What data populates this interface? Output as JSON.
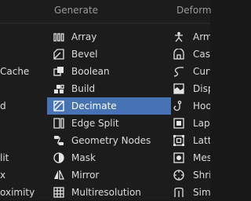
{
  "menu": {
    "left_items": [
      "Cache",
      "d",
      "lit",
      "x",
      "oximity"
    ],
    "columns": [
      {
        "header": "Generate",
        "items": [
          {
            "label": "Array",
            "icon": "array-icon"
          },
          {
            "label": "Bevel",
            "icon": "bevel-icon"
          },
          {
            "label": "Boolean",
            "icon": "boolean-icon"
          },
          {
            "label": "Build",
            "icon": "build-icon"
          },
          {
            "label": "Decimate",
            "icon": "decimate-icon",
            "active": true
          },
          {
            "label": "Edge Split",
            "icon": "edge-split-icon"
          },
          {
            "label": "Geometry Nodes",
            "icon": "geometry-nodes-icon"
          },
          {
            "label": "Mask",
            "icon": "mask-icon"
          },
          {
            "label": "Mirror",
            "icon": "mirror-icon"
          },
          {
            "label": "Multiresolution",
            "icon": "multiresolution-icon"
          }
        ]
      },
      {
        "header": "Deform",
        "items": [
          {
            "label": "Arm",
            "icon": "armature-icon"
          },
          {
            "label": "Cast",
            "icon": "cast-icon"
          },
          {
            "label": "Curv",
            "icon": "curve-icon"
          },
          {
            "label": "Disp",
            "icon": "displace-icon"
          },
          {
            "label": "Hoo",
            "icon": "hook-icon"
          },
          {
            "label": "Lapl",
            "icon": "laplacian-icon"
          },
          {
            "label": "Latt",
            "icon": "lattice-icon"
          },
          {
            "label": "Mes",
            "icon": "mesh-deform-icon"
          },
          {
            "label": "Shri",
            "icon": "shrinkwrap-icon"
          },
          {
            "label": "Simp",
            "icon": "simple-deform-icon"
          }
        ]
      }
    ],
    "colors": {
      "highlight": "#4772b3",
      "background": "#1c1c1c",
      "header_text": "#9a9a9a"
    }
  }
}
